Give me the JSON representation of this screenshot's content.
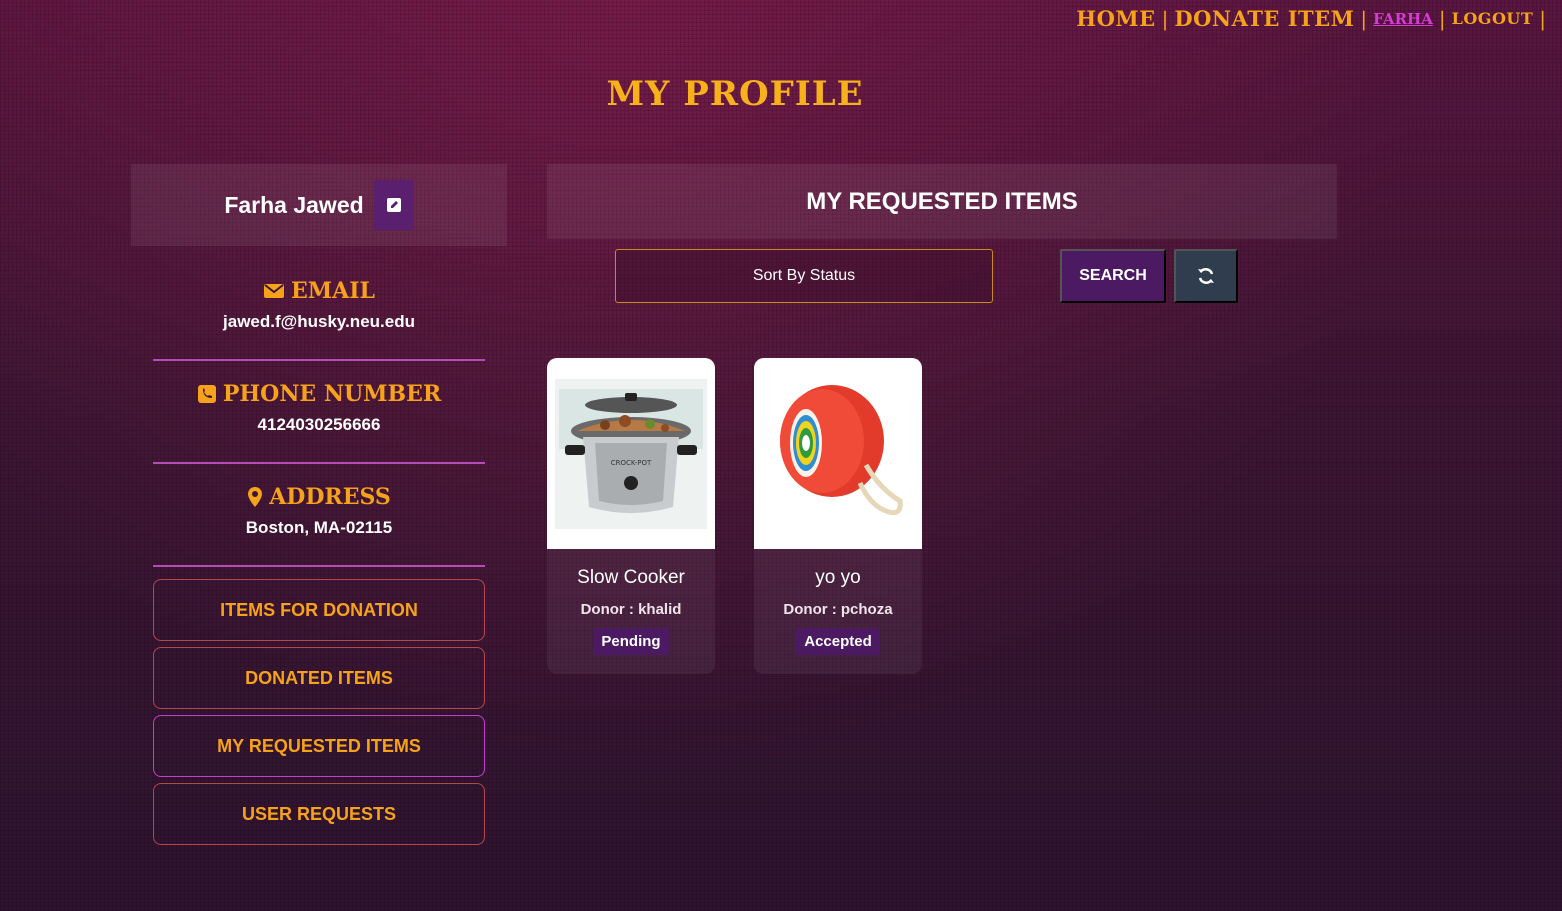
{
  "nav": {
    "home": "HOME",
    "donate": "DONATE ITEM",
    "user": "FARHA",
    "logout": "LOGOUT",
    "sep": "|"
  },
  "page_title": "My Profile",
  "profile": {
    "name": "Farha Jawed",
    "email_label": "Email",
    "email": "jawed.f@husky.neu.edu",
    "phone_label": "Phone Number",
    "phone": "4124030256666",
    "address_label": "Address",
    "address": "Boston, MA-02115"
  },
  "sidebar": {
    "items": [
      {
        "label": "Items For Donation"
      },
      {
        "label": "Donated Items"
      },
      {
        "label": "My Requested Items"
      },
      {
        "label": "User Requests"
      }
    ]
  },
  "main": {
    "header": "My Requested Items",
    "sort_placeholder": "Sort By Status",
    "search_label": "Search"
  },
  "items": [
    {
      "name": "Slow Cooker",
      "donor": "Donor : khalid",
      "status": "Pending",
      "brand": "CROCK-POT"
    },
    {
      "name": "yo yo",
      "donor": "Donor : pchoza",
      "status": "Accepted"
    }
  ],
  "colors": {
    "accent": "#f7a21b",
    "purple": "#4b1a63",
    "magenta": "#d63bd6"
  }
}
